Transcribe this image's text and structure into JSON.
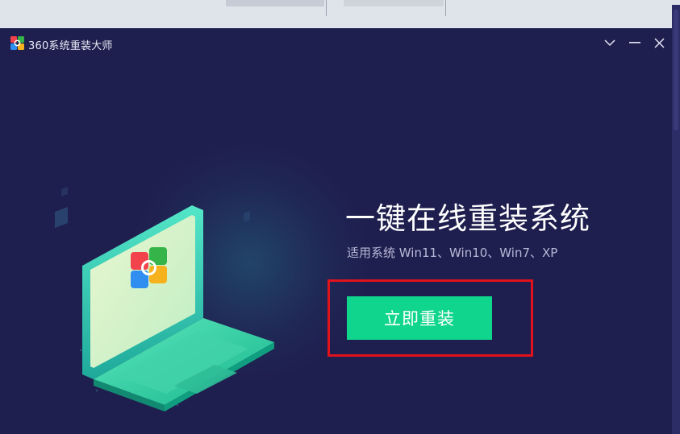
{
  "window": {
    "title": "360系统重装大师",
    "controls": {
      "dropdown_icon": "chevron-down-icon",
      "minimize_icon": "minimize-icon",
      "close_icon": "close-icon"
    }
  },
  "main": {
    "headline": "一键在线重装系统",
    "subtitle": "适用系统 Win11、Win10、Win7、XP",
    "cta_label": "立即重装"
  },
  "colors": {
    "background": "#1f1f4f",
    "accent": "#10d58c",
    "highlight": "#e0121c"
  }
}
